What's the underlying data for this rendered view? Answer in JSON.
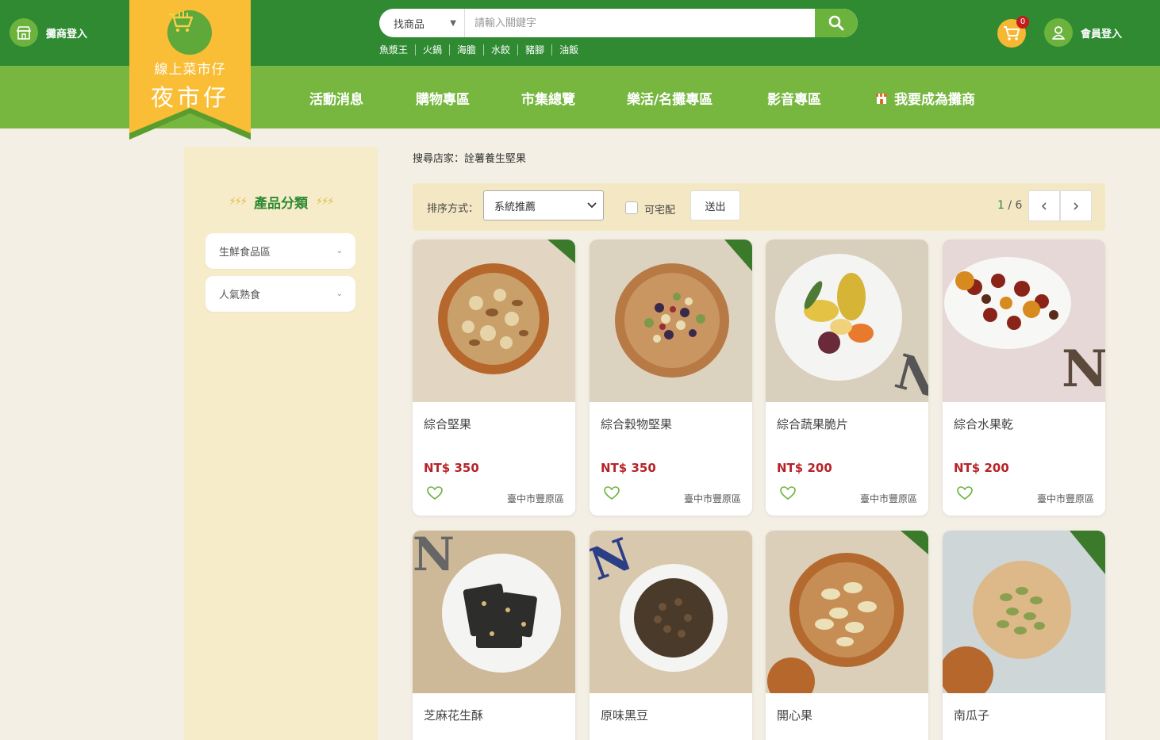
{
  "header": {
    "vendor_login": "攤商登入",
    "logo_line1": "線上菜市仔",
    "logo_line2": "夜市仔",
    "search_category": "找商品",
    "search_placeholder": "請輸入關鍵字",
    "hot_tags": [
      "魚漿王",
      "火鍋",
      "海膽",
      "水餃",
      "豬腳",
      "油飯"
    ],
    "cart_count": "0",
    "member_login": "會員登入"
  },
  "nav": {
    "items": [
      "活動消息",
      "購物專區",
      "市集總覽",
      "樂活/名攤專區",
      "影音專區",
      "我要成為攤商"
    ]
  },
  "sidebar": {
    "title": "產品分類",
    "categories": [
      "生鮮食品區",
      "人氣熟食"
    ]
  },
  "content": {
    "breadcrumb": "搜尋店家：詮薯養生堅果",
    "sort_label": "排序方式：",
    "sort_value": "系統推薦",
    "delivery_label": "可宅配",
    "submit_label": "送出",
    "page_current": "1",
    "page_total": "6",
    "page_separator": "/"
  },
  "products": [
    {
      "name": "綜合堅果",
      "price": "NT$ 350",
      "location": "臺中市豐原區"
    },
    {
      "name": "綜合穀物堅果",
      "price": "NT$ 350",
      "location": "臺中市豐原區"
    },
    {
      "name": "綜合蔬果脆片",
      "price": "NT$ 200",
      "location": "臺中市豐原區"
    },
    {
      "name": "綜合水果乾",
      "price": "NT$ 200",
      "location": "臺中市豐原區"
    },
    {
      "name": "芝麻花生酥"
    },
    {
      "name": "原味黑豆"
    },
    {
      "name": "開心果"
    },
    {
      "name": "南瓜子"
    }
  ],
  "colors": {
    "top_green": "#2f8a32",
    "nav_green": "#77b740",
    "accent_yellow": "#f6b733",
    "price_red": "#b8232a"
  }
}
